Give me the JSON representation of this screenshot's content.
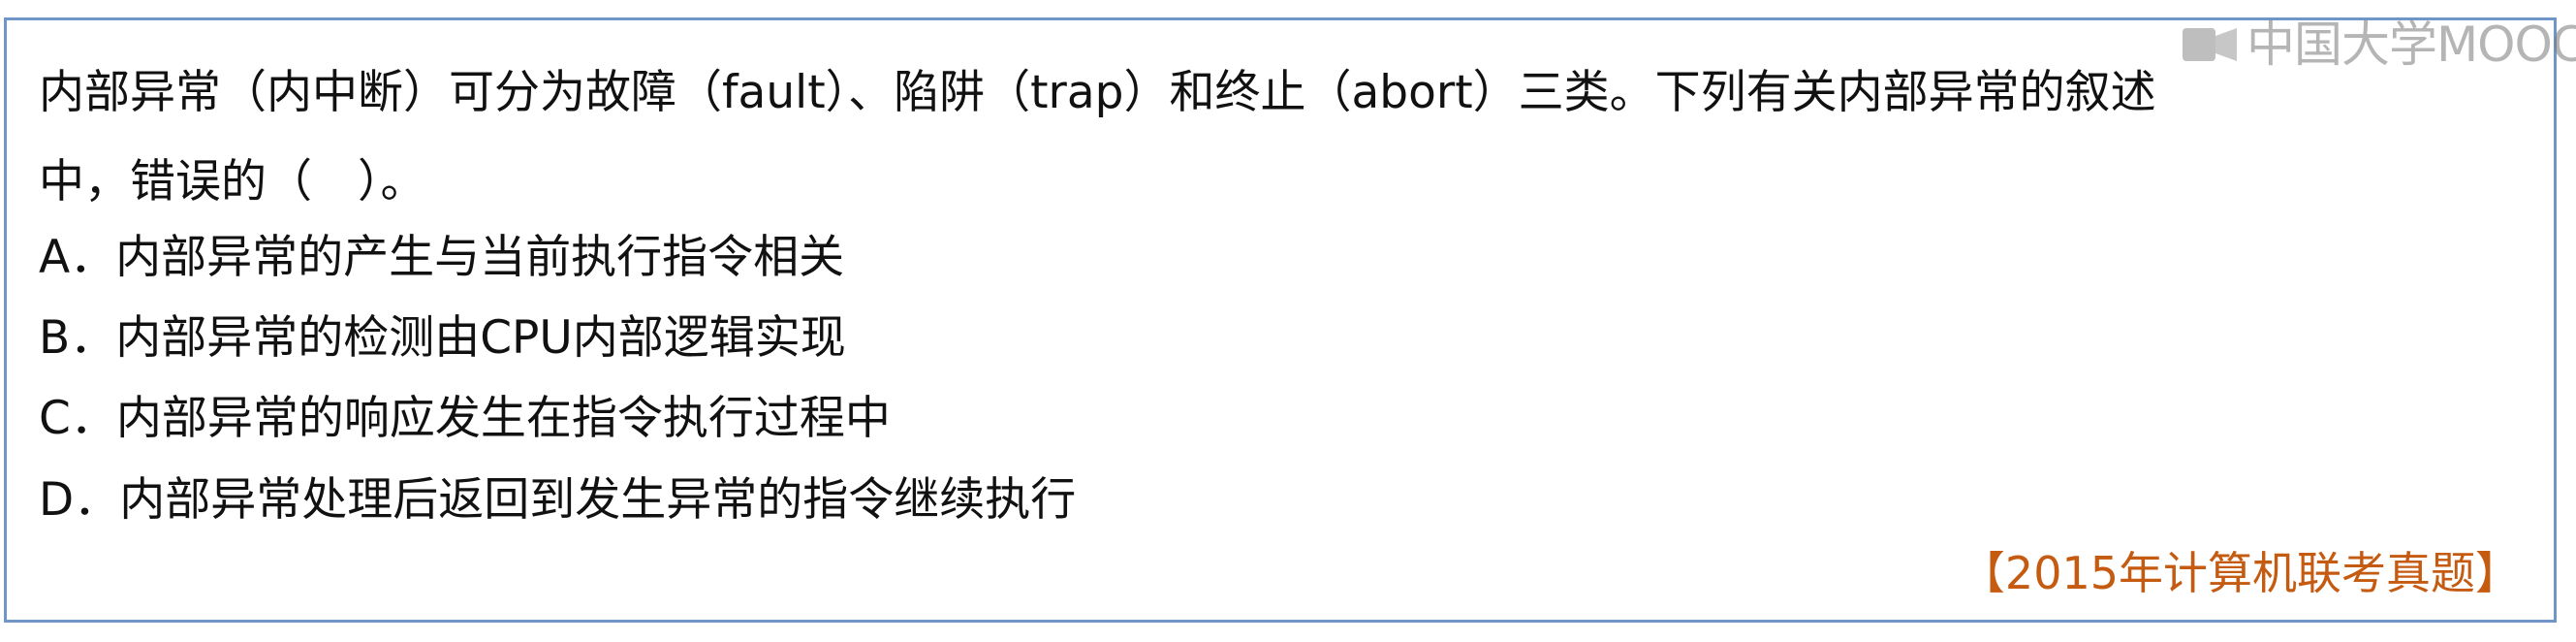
{
  "watermark": {
    "text": "中国大学MOOC",
    "icon": "mooc-logo-icon"
  },
  "question": {
    "stem_line1": "内部异常（内中断）可分为故障（fault）、陷阱（trap）和终止（abort）三类。下列有关内部异常的叙述",
    "stem_line2": "中，错误的（　）。",
    "options": [
      {
        "label": "A．内部异常的产生与当前执行指令相关"
      },
      {
        "label": "B．内部异常的检测由CPU内部逻辑实现"
      },
      {
        "label": "C．内部异常的响应发生在指令执行过程中"
      },
      {
        "label": "D．内部异常处理后返回到发生异常的指令继续执行"
      }
    ],
    "source": "【2015年计算机联考真题】"
  },
  "colors": {
    "border": "#6f96c6",
    "text": "#111111",
    "source": "#c55a11",
    "watermark": "#7a7a7a"
  }
}
